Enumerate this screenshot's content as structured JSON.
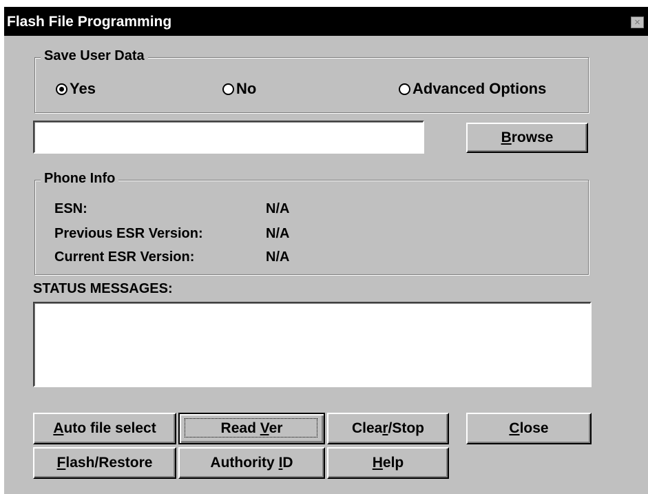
{
  "window": {
    "title": "Flash File Programming",
    "close_glyph": "×"
  },
  "save_user_data": {
    "legend": "Save User Data",
    "options": [
      {
        "label": "Yes",
        "selected": true
      },
      {
        "label": "No",
        "selected": false
      },
      {
        "label": "Advanced Options",
        "selected": false
      }
    ]
  },
  "file_path": {
    "value": "",
    "placeholder": ""
  },
  "browse": {
    "mnemonic": "B",
    "rest": "rowse"
  },
  "phone_info": {
    "legend": "Phone Info",
    "rows": [
      {
        "label": "ESN:",
        "value": "N/A"
      },
      {
        "label": "Previous ESR Version:",
        "value": "N/A"
      },
      {
        "label": "Current ESR Version:",
        "value": "N/A"
      }
    ]
  },
  "status": {
    "label": "STATUS MESSAGES:",
    "text": ""
  },
  "buttons": {
    "auto_file_select": {
      "mnemonic": "A",
      "rest": "uto file select"
    },
    "read_ver": {
      "before": "Read ",
      "mnemonic": "V",
      "after": "er"
    },
    "clear_stop": {
      "before": "Clea",
      "mnemonic": "r",
      "after": "/Stop"
    },
    "close": {
      "mnemonic": "C",
      "rest": "lose"
    },
    "flash_restore": {
      "mnemonic": "F",
      "rest": "lash/Restore"
    },
    "authority_id": {
      "before": "Authority ",
      "mnemonic": "I",
      "after": "D"
    },
    "help": {
      "mnemonic": "H",
      "rest": "elp"
    }
  },
  "colors": {
    "face": "#c0c0c0",
    "titlebar": "#000000",
    "title_text": "#ffffff"
  }
}
